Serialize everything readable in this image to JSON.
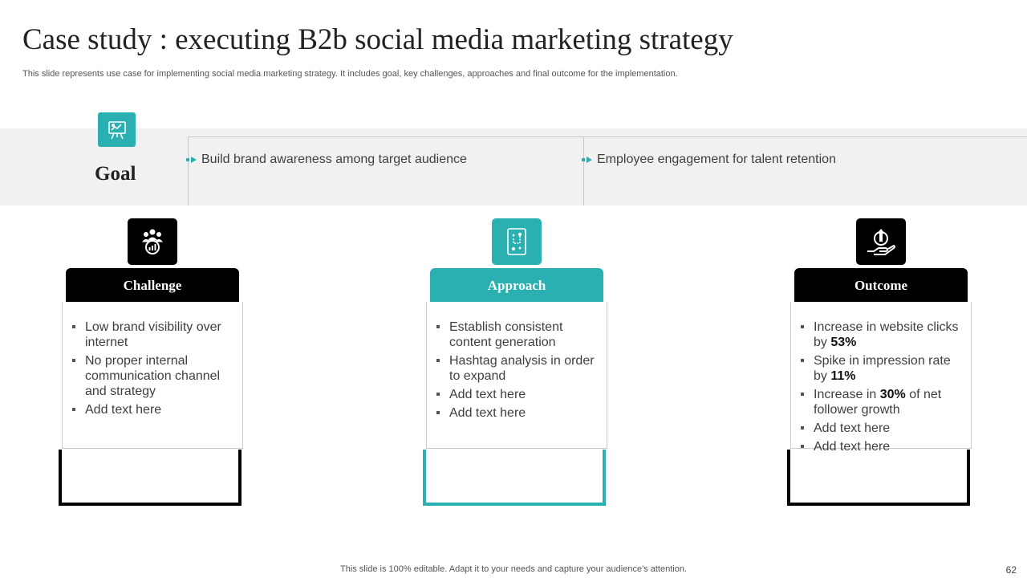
{
  "title": "Case study : executing B2b social media marketing strategy",
  "subtitle": "This slide represents use case for implementing social media marketing strategy. It includes goal, key challenges, approaches and final outcome for the implementation.",
  "goal": {
    "label": "Goal",
    "icon": "presentation-board-icon",
    "items": [
      "Build brand awareness among target audience",
      "Employee engagement for talent retention"
    ]
  },
  "columns": [
    {
      "header": "Challenge",
      "icon": "team-analytics-icon",
      "accent": "#000000",
      "items": [
        {
          "text": "Low brand visibility over internet"
        },
        {
          "text": "No proper internal communication channel and strategy"
        },
        {
          "text": "Add text here"
        }
      ]
    },
    {
      "header": "Approach",
      "icon": "strategy-plan-icon",
      "accent": "#2ab0b0",
      "items": [
        {
          "text": "Establish consistent content generation"
        },
        {
          "text": "Hashtag analysis in order to expand"
        },
        {
          "text": "Add text here"
        },
        {
          "text": "Add text here"
        }
      ]
    },
    {
      "header": "Outcome",
      "icon": "growth-hand-icon",
      "accent": "#000000",
      "items": [
        {
          "pre": "Increase in website clicks by ",
          "bold": "53%",
          "post": ""
        },
        {
          "pre": "Spike in impression rate by ",
          "bold": "11%",
          "post": ""
        },
        {
          "pre": "Increase in ",
          "bold": "30%",
          "post": " of net follower growth"
        },
        {
          "text": "Add text here"
        },
        {
          "text": "Add text here"
        }
      ]
    }
  ],
  "footer": "This slide is 100% editable. Adapt it to your needs and capture your audience's attention.",
  "page_number": "62",
  "colors": {
    "teal": "#2ab0b0",
    "black": "#000000",
    "band": "#f1f1f1"
  }
}
